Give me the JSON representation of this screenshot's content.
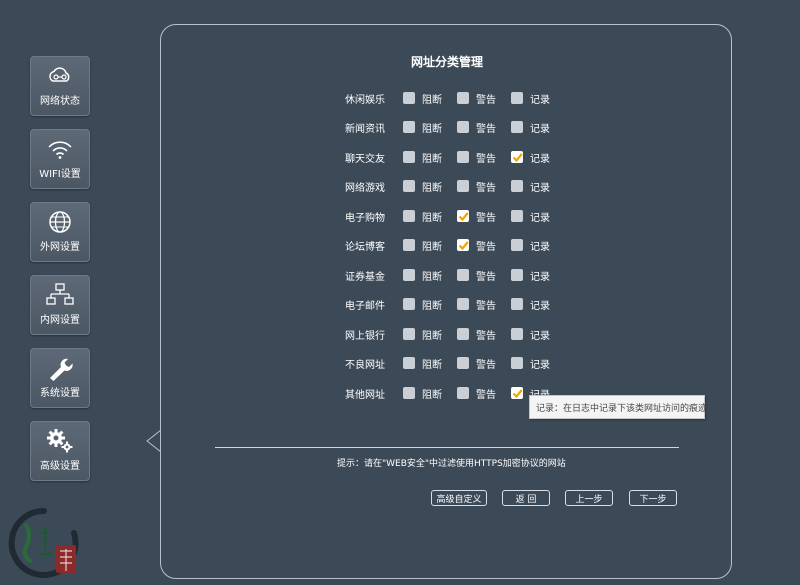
{
  "sidebar": {
    "items": [
      {
        "label": "网络状态",
        "icon": "cloud-network-icon"
      },
      {
        "label": "WIFI设置",
        "icon": "wifi-icon"
      },
      {
        "label": "外网设置",
        "icon": "globe-icon"
      },
      {
        "label": "内网设置",
        "icon": "lan-topology-icon"
      },
      {
        "label": "系统设置",
        "icon": "wrench-icon"
      },
      {
        "label": "高级设置",
        "icon": "gears-icon"
      }
    ]
  },
  "panel": {
    "title": "网址分类管理",
    "option_labels": {
      "block": "阻断",
      "warn": "警告",
      "log": "记录"
    },
    "categories": [
      {
        "name": "休闲娱乐",
        "block": false,
        "warn": false,
        "log": false
      },
      {
        "name": "新闻资讯",
        "block": false,
        "warn": false,
        "log": false
      },
      {
        "name": "聊天交友",
        "block": false,
        "warn": false,
        "log": true
      },
      {
        "name": "网络游戏",
        "block": false,
        "warn": false,
        "log": false
      },
      {
        "name": "电子购物",
        "block": false,
        "warn": true,
        "log": false
      },
      {
        "name": "论坛博客",
        "block": false,
        "warn": true,
        "log": false
      },
      {
        "name": "证券基金",
        "block": false,
        "warn": false,
        "log": false
      },
      {
        "name": "电子邮件",
        "block": false,
        "warn": false,
        "log": false
      },
      {
        "name": "网上银行",
        "block": false,
        "warn": false,
        "log": false
      },
      {
        "name": "不良网址",
        "block": false,
        "warn": false,
        "log": false
      },
      {
        "name": "其他网址",
        "block": false,
        "warn": false,
        "log": true
      }
    ],
    "hint": "提示：请在\"WEB安全\"中过滤使用HTTPS加密协议的网站",
    "buttons": {
      "custom": "高级自定义",
      "back": "返 回",
      "prev": "上一步",
      "next": "下一步"
    }
  },
  "tooltip": {
    "text": "记录：在日志中记录下该类网址访问的痕迹"
  },
  "colors": {
    "background": "#3c4a58",
    "check_accent": "#f0a500"
  }
}
